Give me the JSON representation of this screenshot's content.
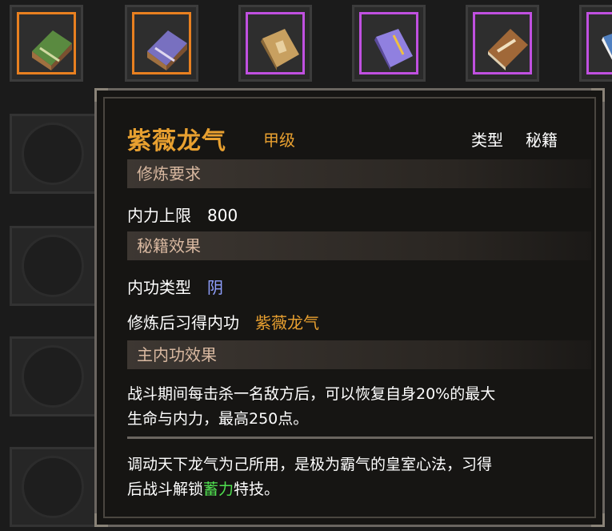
{
  "top_slots": [
    {
      "border": "orange",
      "book": "green-scroll-book-icon",
      "color": "#6a9a50"
    },
    {
      "border": "orange",
      "book": "purple-scroll-book-icon",
      "color": "#8078c8"
    },
    {
      "border": "purple",
      "book": "tan-book-icon",
      "color": "#c8a060"
    },
    {
      "border": "purple",
      "book": "purple-book-icon",
      "color": "#9080e0"
    },
    {
      "border": "purple",
      "book": "brown-book-icon",
      "color": "#a06838"
    },
    {
      "border": "purple",
      "book": "blue-book-icon",
      "color": "#5080c0"
    }
  ],
  "tooltip": {
    "title": "紫薇龙气",
    "grade": "甲级",
    "type_label": "类型",
    "type_value": "秘籍",
    "section_requirements": "修炼要求",
    "req_label": "内力上限",
    "req_value": "800",
    "section_effects": "秘籍效果",
    "neigong_type_label": "内功类型",
    "neigong_type_value": "阴",
    "learn_label": "修炼后习得内功",
    "learn_value": "紫薇龙气",
    "section_main": "主内功效果",
    "main_effect_line1": "战斗期间每击杀一名敌方后，可以恢复自身20%的最大",
    "main_effect_line2": "生命与内力，最高250点。",
    "desc_line1": "调动天下龙气为己所用，是极为霸气的皇室心法，习得",
    "desc_line2_pre": "后战斗解锁",
    "desc_line2_skill": "蓄力",
    "desc_line2_post": "特技。"
  },
  "colors": {
    "accent_gold": "#e8a030",
    "yin_blue": "#90a0ff",
    "skill_green": "#50e050",
    "slot_orange": "#e88020",
    "slot_purple": "#c050e0"
  }
}
